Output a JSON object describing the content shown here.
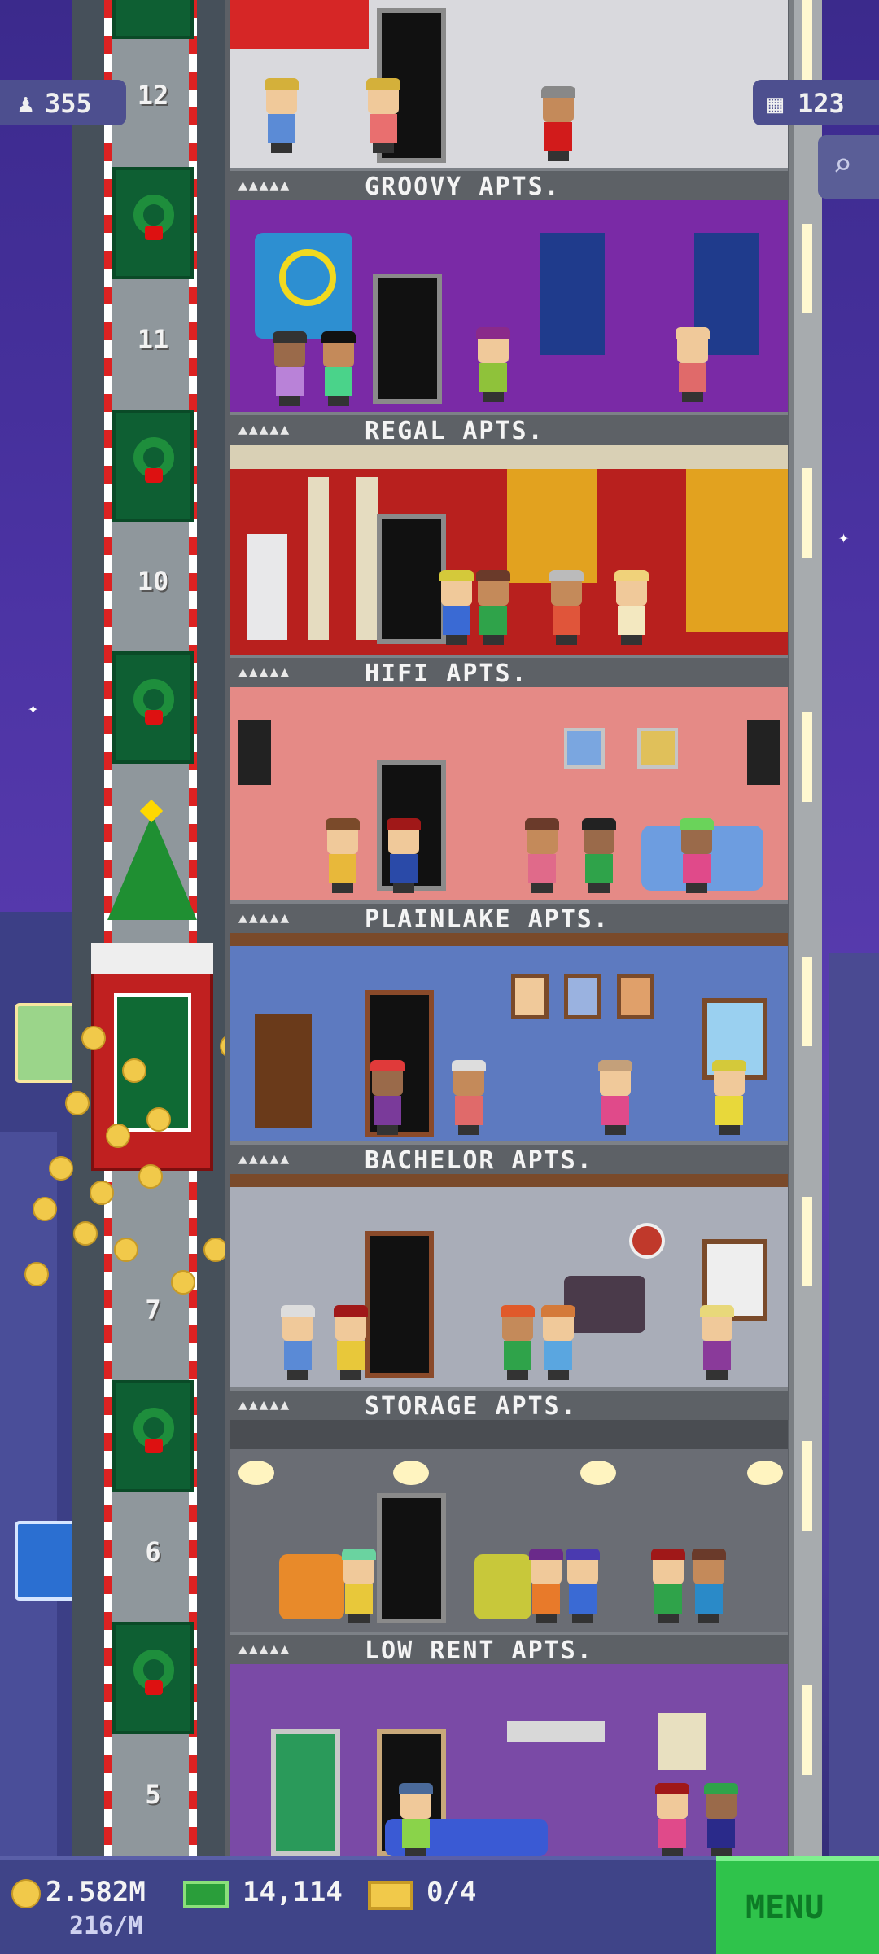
{
  "hud": {
    "population": "355",
    "floors": "123"
  },
  "shaft_floors": [
    "12",
    "11",
    "10",
    "7",
    "6",
    "5"
  ],
  "floors": [
    {
      "name": "GROOVY APTS.",
      "stars": "▲▲▲▲▲",
      "wall": "#c8c8cc"
    },
    {
      "name": "REGAL APTS.",
      "stars": "▲▲▲▲▲",
      "wall": "#7a2aa6"
    },
    {
      "name": "HIFI APTS.",
      "stars": "▲▲▲▲▲",
      "wall": "#b8201e"
    },
    {
      "name": "PLAINLAKE APTS.",
      "stars": "▲▲▲▲▲",
      "wall": "#e58a86"
    },
    {
      "name": "BACHELOR APTS.",
      "stars": "▲▲▲▲▲",
      "wall": "#5d7ac0"
    },
    {
      "name": "STORAGE APTS.",
      "stars": "▲▲▲▲▲",
      "wall": "#a9adb8"
    },
    {
      "name": "LOW RENT APTS.",
      "stars": "▲▲▲▲▲",
      "wall": "#6a6d74"
    }
  ],
  "bottom": {
    "coins": "2.582M",
    "coins_rate": "216/M",
    "bux": "14,114",
    "tickets": "0/4",
    "menu": "MENU"
  },
  "colors": {
    "coin": "#f1c94a",
    "bux": "#2a9e3a",
    "menu": "#2fc34b"
  }
}
